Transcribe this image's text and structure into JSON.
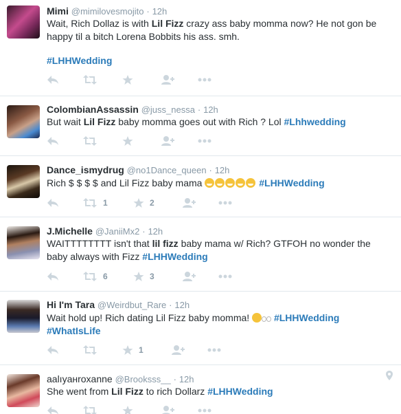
{
  "colors": {
    "hashtag": "#2b7bb9",
    "meta": "#8899a6",
    "icon": "#ccd6dd",
    "divider": "#e1e8ed",
    "text": "#292f33"
  },
  "tweets": [
    {
      "fullname": "Mimi",
      "username": "@mimilovesmojito",
      "sep": "·",
      "time": "12h",
      "text_a": "Wait, Rich Dollaz is with ",
      "bold": "Lil Fizz",
      "text_b": " crazy ass baby momma now? He not gon be happy til a bitch Lorena Bobbits his ass. smh.",
      "hashtag": "#LHHWedding",
      "retweets": "",
      "favorites": ""
    },
    {
      "fullname": "ColombianAssassin",
      "username": "@juss_nessa",
      "sep": "·",
      "time": "12h",
      "text_a": "But wait ",
      "bold": "Lil Fizz",
      "text_b": " baby momma goes out with Rich ? Lol ",
      "hashtag": "#Lhhwedding",
      "retweets": "",
      "favorites": ""
    },
    {
      "fullname": "Dance_ismydrug",
      "username": "@no1Dance_queen",
      "sep": "·",
      "time": "12h",
      "text_a": "Rich  $ $ $ $  and Lil Fizz baby mama ",
      "bold": "",
      "text_b": " ",
      "hashtag": "#LHHWedding",
      "retweets": "1",
      "favorites": "2"
    },
    {
      "fullname": "J.Michelle",
      "username": "@JaniiMx2",
      "sep": "·",
      "time": "12h",
      "text_a": "WAITTTTTTTT isn't that ",
      "bold": "lil fizz",
      "text_b": " baby mama w/ Rich? GTFOH no wonder the baby always with Fizz ",
      "hashtag": "#LHHWedding",
      "retweets": "6",
      "favorites": "3"
    },
    {
      "fullname": "Hi I'm Tara",
      "username": "@Weirdbut_Rare",
      "sep": "·",
      "time": "12h",
      "text_a": "Wait hold up! Rich dating Lil Fizz baby momma! ",
      "bold": "",
      "text_b": " ",
      "hashtag": "#LHHWedding",
      "hashtag2": "#WhatIsLife",
      "retweets": "",
      "favorites": "1"
    },
    {
      "fullname": "aalıyaнroxanne",
      "username": "@Brooksss__",
      "sep": "·",
      "time": "12h",
      "text_a": "She went from ",
      "bold": "Lil Fizz",
      "text_b": " to rich Dollarz ",
      "hashtag": "#LHHWedding",
      "retweets": "",
      "favorites": ""
    }
  ]
}
